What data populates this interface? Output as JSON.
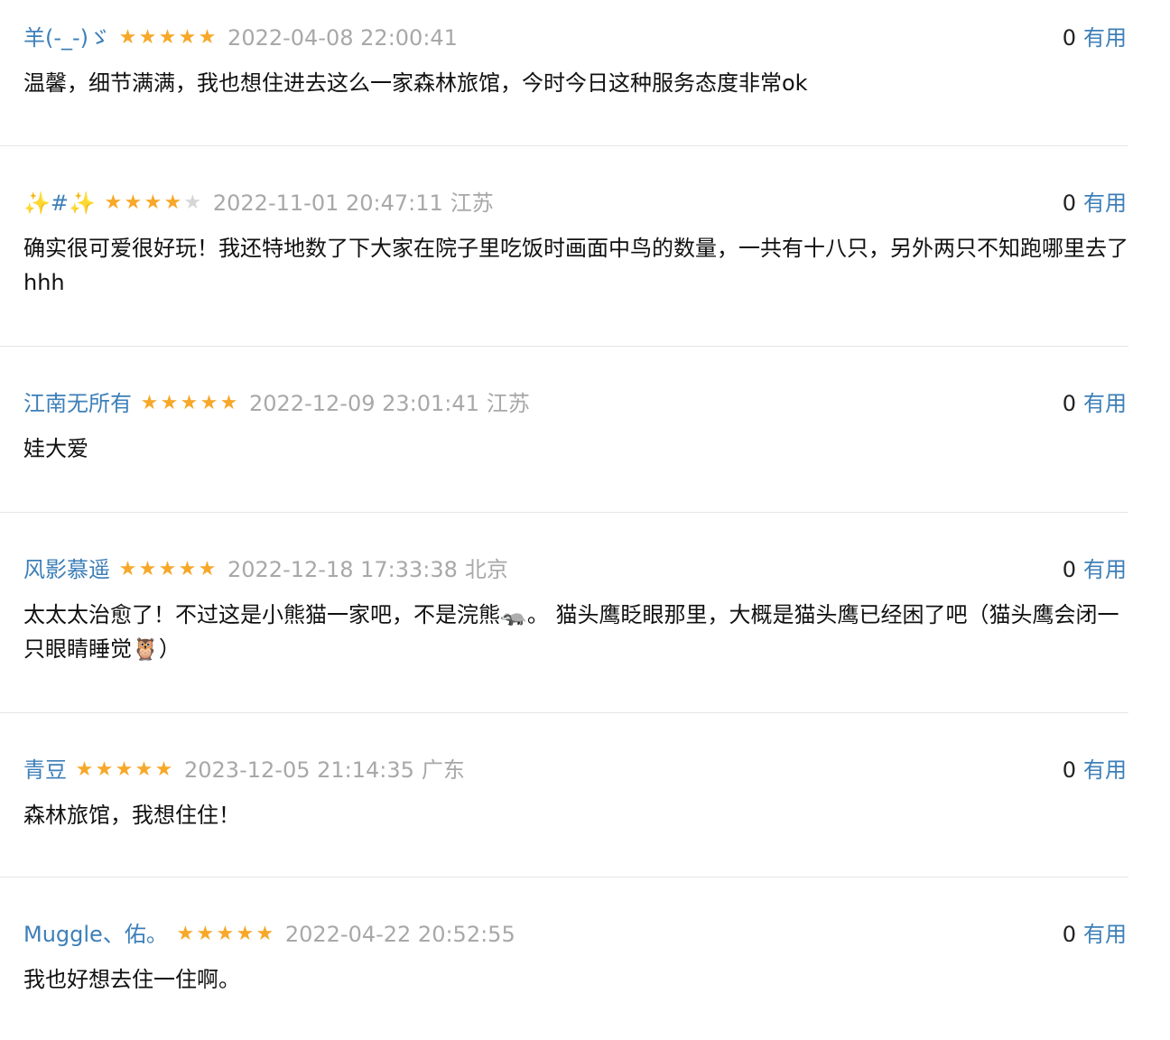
{
  "comments": [
    {
      "user": "羊(-_-)ゞ",
      "rating": 5,
      "time": "2022-04-08 22:00:41",
      "region": "",
      "content": "温馨，细节满满，我也想住进去这么一家森林旅馆，今时今日这种服务态度非常ok",
      "votes": "0",
      "vote_label": "有用"
    },
    {
      "user": "✨#✨",
      "rating": 4,
      "time": "2022-11-01 20:47:11",
      "region": "江苏",
      "content": "确实很可爱很好玩！我还特地数了下大家在院子里吃饭时画面中鸟的数量，一共有十八只，另外两只不知跑哪里去了hhh",
      "votes": "0",
      "vote_label": "有用"
    },
    {
      "user": "江南无所有",
      "rating": 5,
      "time": "2022-12-09 23:01:41",
      "region": "江苏",
      "content": "娃大爱",
      "votes": "0",
      "vote_label": "有用"
    },
    {
      "user": "风影慕遥",
      "rating": 5,
      "time": "2022-12-18 17:33:38",
      "region": "北京",
      "content": "太太太治愈了！不过这是小熊猫一家吧，不是浣熊🦡。 猫头鹰眨眼那里，大概是猫头鹰已经困了吧（猫头鹰会闭一只眼睛睡觉🦉）",
      "votes": "0",
      "vote_label": "有用"
    },
    {
      "user": "青豆",
      "rating": 5,
      "time": "2023-12-05 21:14:35",
      "region": "广东",
      "content": "森林旅馆，我想住住！",
      "votes": "0",
      "vote_label": "有用"
    },
    {
      "user": "Muggle、佑。",
      "rating": 5,
      "time": "2022-04-22 20:52:55",
      "region": "",
      "content": "我也好想去住一住啊。",
      "votes": "0",
      "vote_label": "有用"
    }
  ],
  "colors": {
    "username": "#3d7fb8",
    "star_on": "#f7a829",
    "star_off": "#d6d6d6",
    "meta_gray": "#a8a8a8",
    "divider": "#e6e6e6"
  },
  "icons": {
    "star": "star-icon"
  }
}
